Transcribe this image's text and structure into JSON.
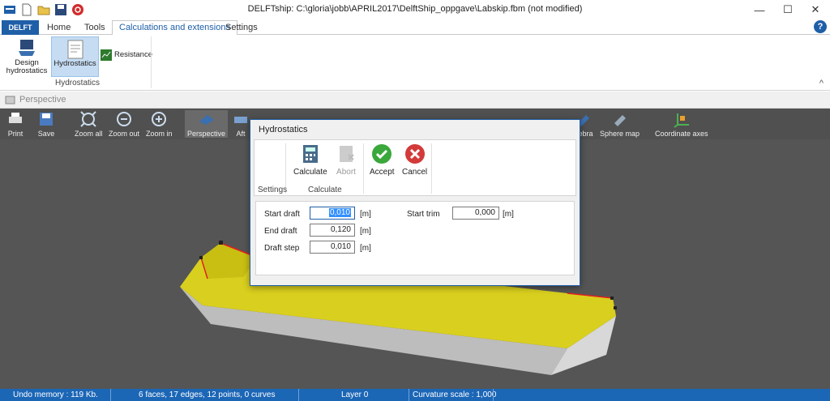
{
  "window": {
    "title": "DELFTship: C:\\gloria\\jobb\\APRIL2017\\DelftShip_oppgave\\Labskip.fbm (not modified)",
    "minimize": "—",
    "maximize": "☐",
    "close": "✕"
  },
  "ribbon_tabs": {
    "app": "DELFT",
    "items": [
      "Home",
      "Tools",
      "Calculations and extensions",
      "Settings"
    ],
    "help": "?"
  },
  "ribbon": {
    "design_hydrostatics": "Design hydrostatics",
    "hydrostatics": "Hydrostatics",
    "resistance": "Resistance",
    "group_label": "Hydrostatics",
    "collapse": "^"
  },
  "perspective_bar": {
    "label": "Perspective"
  },
  "viewport_toolbar": {
    "print": "Print",
    "save": "Save",
    "zoom_all": "Zoom all",
    "zoom_out": "Zoom out",
    "zoom_in": "Zoom in",
    "perspective": "Perspective",
    "aft": "Aft",
    "zebra": "Zebra",
    "sphere_map": "Sphere map",
    "coordinate_axes": "Coordinate axes"
  },
  "dialog": {
    "title": "Hydrostatics",
    "calculate": "Calculate",
    "abort": "Abort",
    "accept": "Accept",
    "cancel": "Cancel",
    "group_settings": "Settings",
    "group_calculate": "Calculate",
    "start_draft_label": "Start draft",
    "start_draft": "0,010",
    "end_draft_label": "End draft",
    "end_draft": "0,120",
    "draft_step_label": "Draft step",
    "draft_step": "0,010",
    "start_trim_label": "Start trim",
    "start_trim": "0,000",
    "unit": "[m]"
  },
  "statusbar": {
    "undo": "Undo memory : 119 Kb.",
    "geometry": "6 faces, 17 edges, 12 points, 0 curves",
    "layer": "Layer 0",
    "curvature": "Curvature scale : 1,000"
  },
  "colors": {
    "accent": "#1f5fa8",
    "status_bar": "#1c66b6",
    "viewport_bg": "#555555",
    "hull_deck": "#d4c91c",
    "hull_side": "#c8c8c8"
  }
}
